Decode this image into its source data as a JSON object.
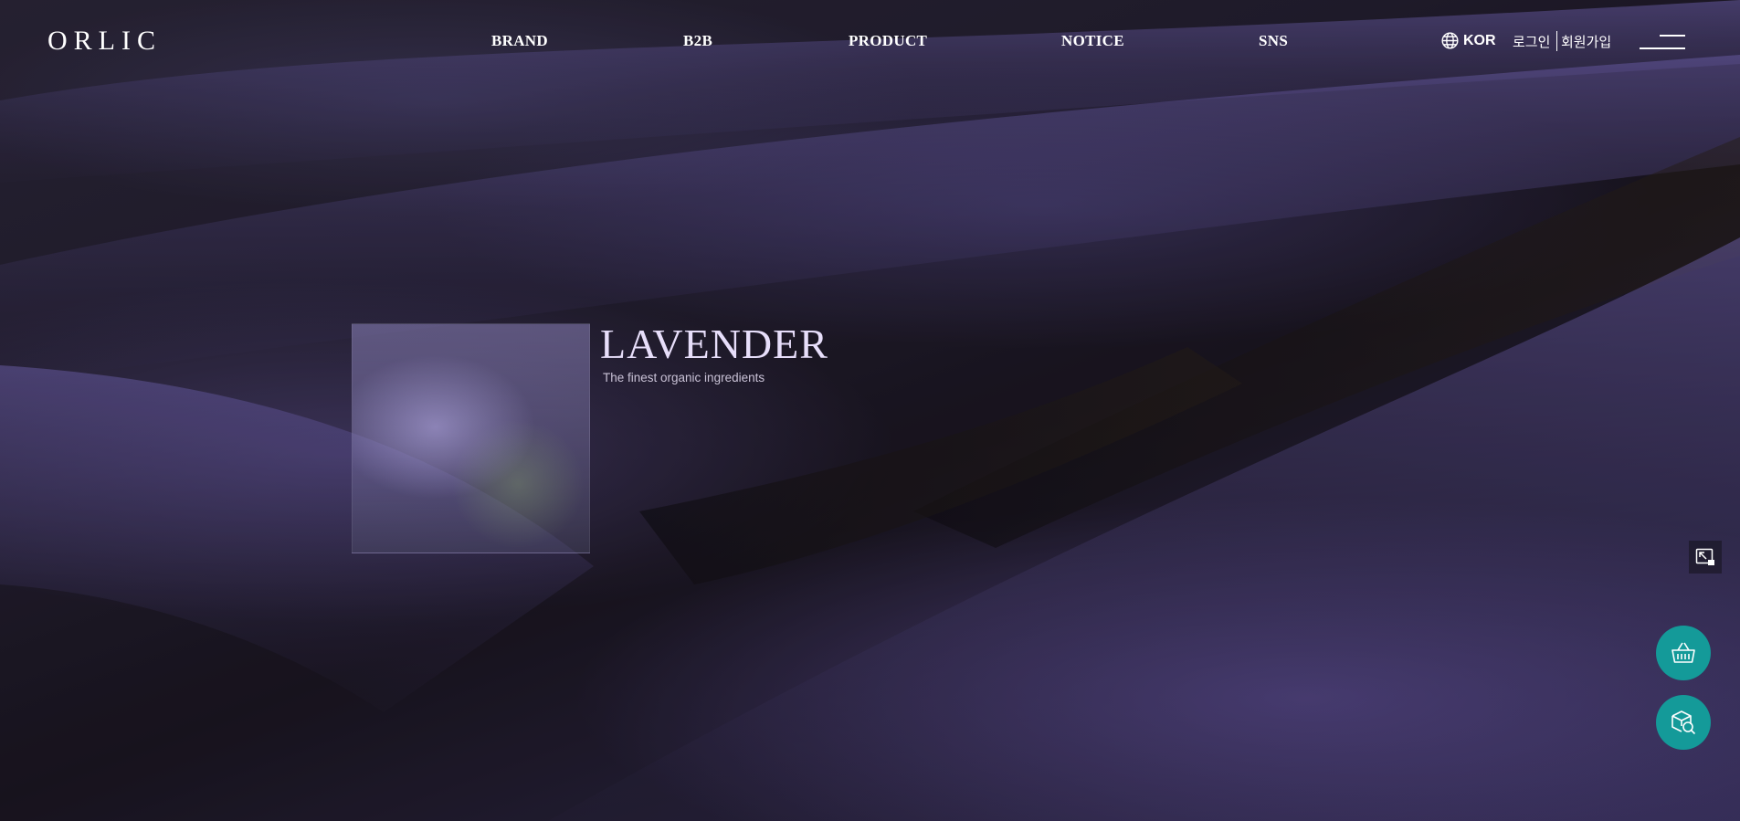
{
  "brand": {
    "logo_text": "ORLIC"
  },
  "nav": {
    "items": [
      {
        "label": "BRAND"
      },
      {
        "label": "B2B"
      },
      {
        "label": "PRODUCT"
      },
      {
        "label": "NOTICE"
      },
      {
        "label": "SNS"
      }
    ]
  },
  "util": {
    "lang_icon": "globe-icon",
    "language": "KOR",
    "login": "로그인",
    "join": "회원가입",
    "menu_icon": "hamburger-icon"
  },
  "hero": {
    "title": "LAVENDER",
    "subtitle": "The finest organic ingredients"
  },
  "floating": {
    "side_icon": "exit-fullscreen-icon",
    "cart_icon": "basket-icon",
    "search_icon": "product-search-icon"
  },
  "colors": {
    "accent": "#149a99",
    "text": "#ffffff",
    "hero_title": "#e7defa"
  }
}
